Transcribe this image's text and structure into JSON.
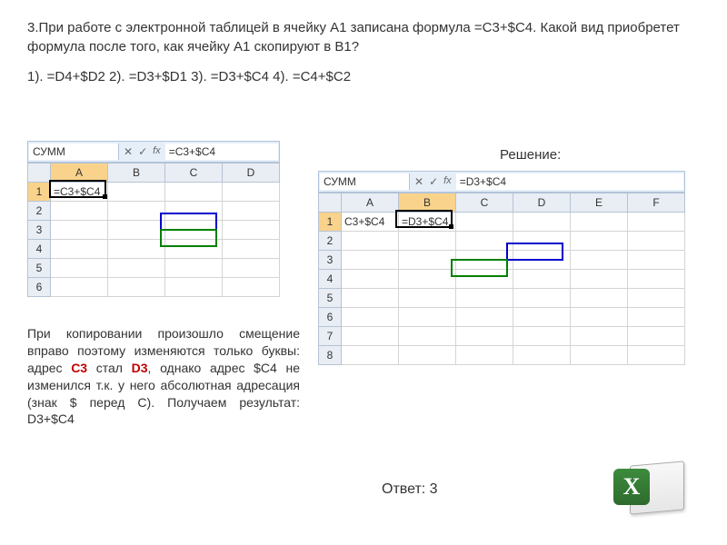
{
  "question": "3.При работе с электронной таблицей в ячейку А1 записана формула =С3+$C4. Какой вид приобретет формула после того, как  ячейку А1 скопируют в В1?",
  "options": "1). =D4+$D2    2). =D3+$D1    3). =D3+$C4    4). =C4+$C2",
  "solution_label": "Решение:",
  "shot1": {
    "name_box": "СУММ",
    "formula": "=C3+$C4",
    "columns": [
      "A",
      "B",
      "C",
      "D"
    ],
    "rows": [
      "1",
      "2",
      "3",
      "4",
      "5",
      "6"
    ],
    "a1": "=C3+$C4"
  },
  "shot2": {
    "name_box": "СУММ",
    "formula": "=D3+$C4",
    "columns": [
      "A",
      "B",
      "C",
      "D",
      "E",
      "F"
    ],
    "rows": [
      "1",
      "2",
      "3",
      "4",
      "5",
      "6",
      "7",
      "8"
    ],
    "a1": "C3+$C4",
    "b1": "=D3+$C4"
  },
  "explanation_parts": {
    "p1": "При копировании произошло смещение вправо поэтому изменяются только буквы: адрес ",
    "c3": "С3",
    "p2": " стал ",
    "d3": "D3",
    "p3": ", однако адрес $С4 не изменился т.к. у него абсолютная адресация (знак $ перед С). Получаем результат: D3+$C4"
  },
  "answer": "Ответ: 3",
  "icons": {
    "check": "✓",
    "cross": "✕",
    "fx": "fx"
  }
}
